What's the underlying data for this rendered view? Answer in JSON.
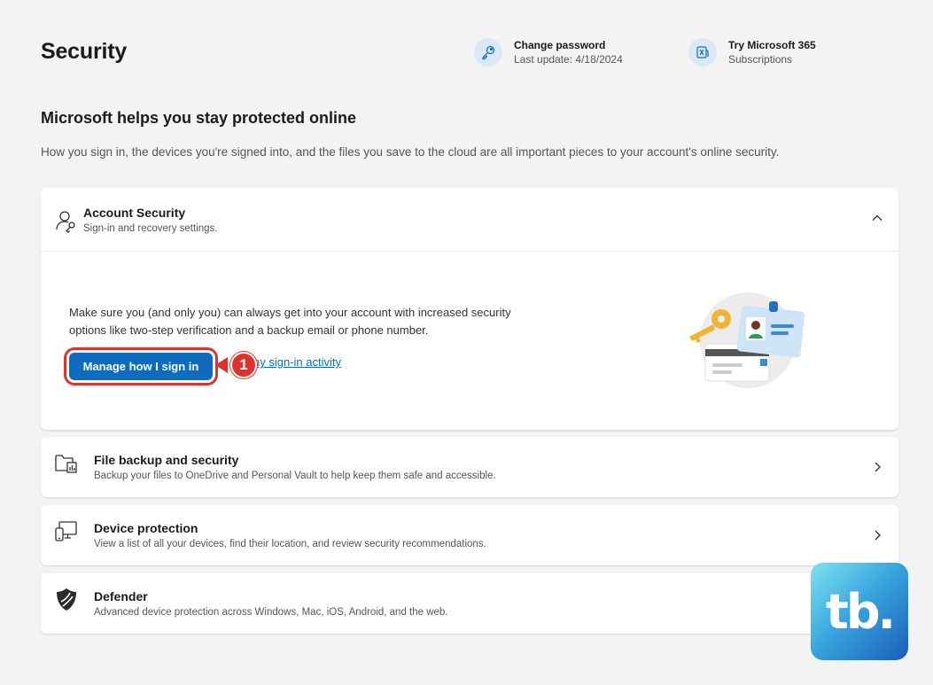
{
  "header": {
    "title": "Security",
    "change_password": {
      "title": "Change password",
      "subtitle": "Last update: 4/18/2024",
      "icon": "key-icon"
    },
    "microsoft365": {
      "title": "Try Microsoft 365",
      "subtitle": "Subscriptions",
      "icon": "m365-icon"
    }
  },
  "intro": {
    "heading": "Microsoft helps you stay protected online",
    "description": "How you sign in, the devices you're signed into, and the files you save to the cloud are all important pieces to your account's online security."
  },
  "account_security": {
    "title": "Account Security",
    "subtitle": "Sign-in and recovery settings.",
    "body": "Make sure you (and only you) can always get into your account with increased security options like two-step verification and a backup email or phone number.",
    "manage_button": "Manage how I sign in",
    "activity_link": "ny sign-in activity",
    "annotation_number": "1"
  },
  "rows": [
    {
      "title": "File backup and security",
      "subtitle": "Backup your files to OneDrive and Personal Vault to help keep them safe and accessible.",
      "icon": "folder-chart-icon"
    },
    {
      "title": "Device protection",
      "subtitle": "View a list of all your devices, find their location, and review security recommendations.",
      "icon": "devices-icon"
    },
    {
      "title": "Defender",
      "subtitle": "Advanced device protection across Windows, Mac, iOS, Android, and the web.",
      "icon": "defender-shield-icon"
    }
  ],
  "watermark": {
    "text": "tb."
  },
  "colors": {
    "accent": "#0f6cbd",
    "annotation": "#e0322b",
    "background": "#f3f3f3"
  }
}
